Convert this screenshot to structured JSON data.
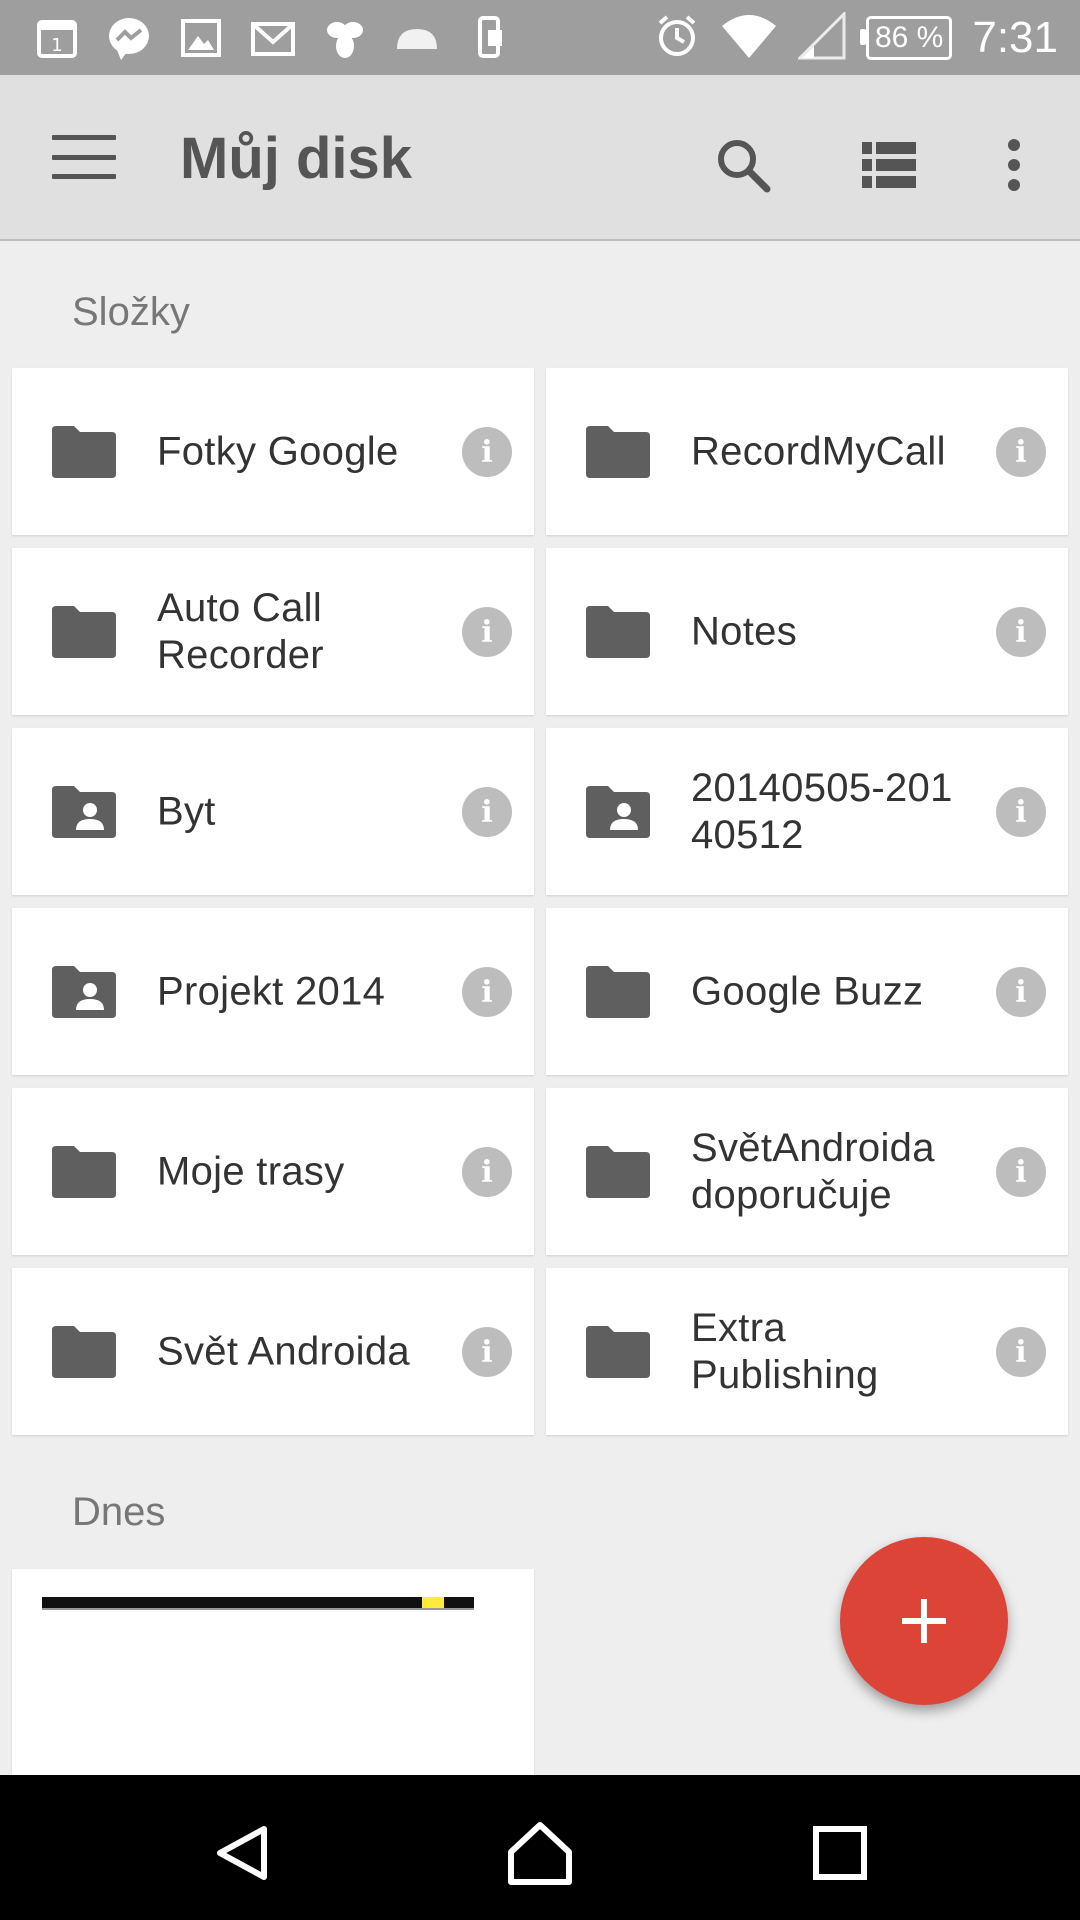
{
  "status_bar": {
    "notification_icons": [
      "calendar-icon",
      "messenger-icon",
      "gallery-icon",
      "gmail-icon",
      "bee-icon",
      "cloud-icon",
      "phone-sync-icon"
    ],
    "battery": "86 %",
    "time": "7:31"
  },
  "app_bar": {
    "title": "Můj disk",
    "actions": [
      "search-icon",
      "list-view-icon",
      "more-vert-icon"
    ]
  },
  "sections": {
    "folders_title": "Složky",
    "today_title": "Dnes"
  },
  "folders": [
    {
      "name": "Fotky Google",
      "shared": false
    },
    {
      "name": "RecordMyCall",
      "shared": false
    },
    {
      "name": "Auto Call Recorder",
      "shared": false
    },
    {
      "name": "Notes",
      "shared": false
    },
    {
      "name": "Byt",
      "shared": true
    },
    {
      "name": "20140505-20140512",
      "shared": true
    },
    {
      "name": "Projekt 2014",
      "shared": true
    },
    {
      "name": "Google Buzz",
      "shared": false
    },
    {
      "name": "Moje trasy",
      "shared": false
    },
    {
      "name": "SvětAndroida doporučuje",
      "shared": false
    },
    {
      "name": "Svět Androida",
      "shared": false
    },
    {
      "name": "Extra Publishing",
      "shared": false
    }
  ],
  "fab": {
    "icon": "add-icon"
  },
  "colors": {
    "accent": "#db4437",
    "appbar": "#e0e0e0",
    "status": "#9e9e9e"
  }
}
